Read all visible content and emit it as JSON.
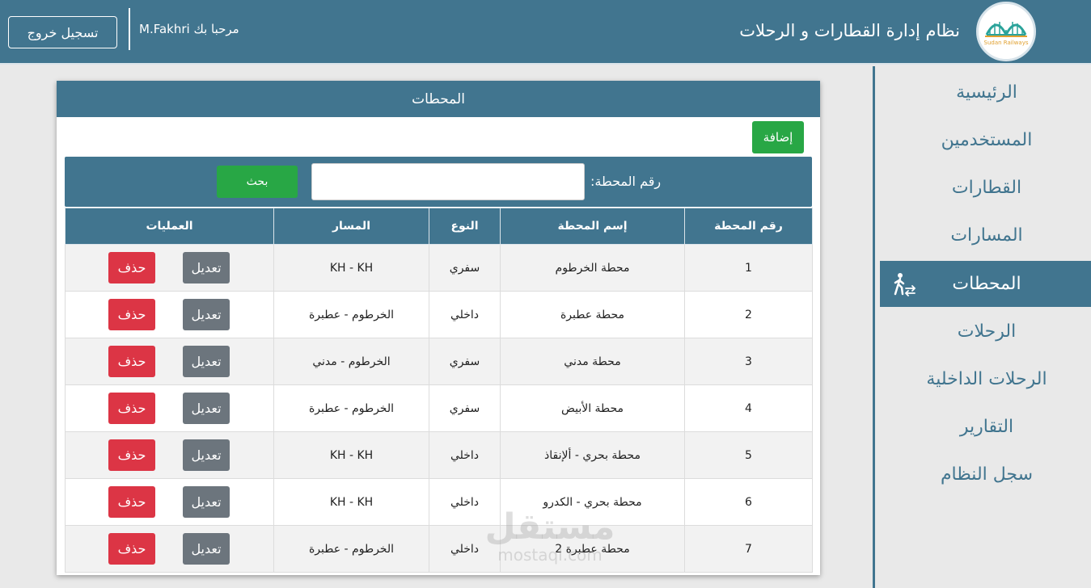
{
  "header": {
    "app_title": "نظام إدارة القطارات و الرحلات",
    "welcome": "مرحبا بك M.Fakhri",
    "logout_label": "تسجيل خروج",
    "logo_text": "Sudan Railways"
  },
  "sidebar": {
    "items": [
      {
        "label": "الرئيسية"
      },
      {
        "label": "المستخدمين"
      },
      {
        "label": "القطارات"
      },
      {
        "label": "المسارات"
      },
      {
        "label": "المحطات",
        "active": true,
        "icon": "pedestrian-transfer-icon"
      },
      {
        "label": "الرحلات"
      },
      {
        "label": "الرحلات الداخلية"
      },
      {
        "label": "التقارير"
      },
      {
        "label": "سجل النظام"
      }
    ]
  },
  "panel": {
    "title": "المحطات",
    "add_label": "إضافة",
    "search_label": "رقم المحطة:",
    "search_value": "",
    "search_button": "بحث"
  },
  "table": {
    "headers": [
      "رقم المحطة",
      "إسم المحطة",
      "النوع",
      "المسار",
      "العمليات"
    ],
    "edit_label": "تعديل",
    "delete_label": "حذف",
    "rows": [
      {
        "no": "1",
        "name": "محطة الخرطوم",
        "type": "سفري",
        "route": "KH - KH"
      },
      {
        "no": "2",
        "name": "محطة عطبرة",
        "type": "داخلي",
        "route": "الخرطوم - عطبرة"
      },
      {
        "no": "3",
        "name": "محطة مدني",
        "type": "سفري",
        "route": "الخرطوم - مدني"
      },
      {
        "no": "4",
        "name": "محطة الأبيض",
        "type": "سفري",
        "route": "الخرطوم - عطبرة"
      },
      {
        "no": "5",
        "name": "محطة بحري - ألإنقاذ",
        "type": "داخلي",
        "route": "KH - KH"
      },
      {
        "no": "6",
        "name": "محطة بحري - الكدرو",
        "type": "داخلي",
        "route": "KH - KH"
      },
      {
        "no": "7",
        "name": "محطة عطبرة 2",
        "type": "داخلي",
        "route": "الخرطوم - عطبرة"
      }
    ]
  },
  "watermark": {
    "logo_text": "مستقل",
    "domain": "mostaql.com"
  },
  "colors": {
    "primary": "#41758f",
    "success": "#28a745",
    "danger": "#dc3545",
    "secondary": "#6c757d"
  }
}
